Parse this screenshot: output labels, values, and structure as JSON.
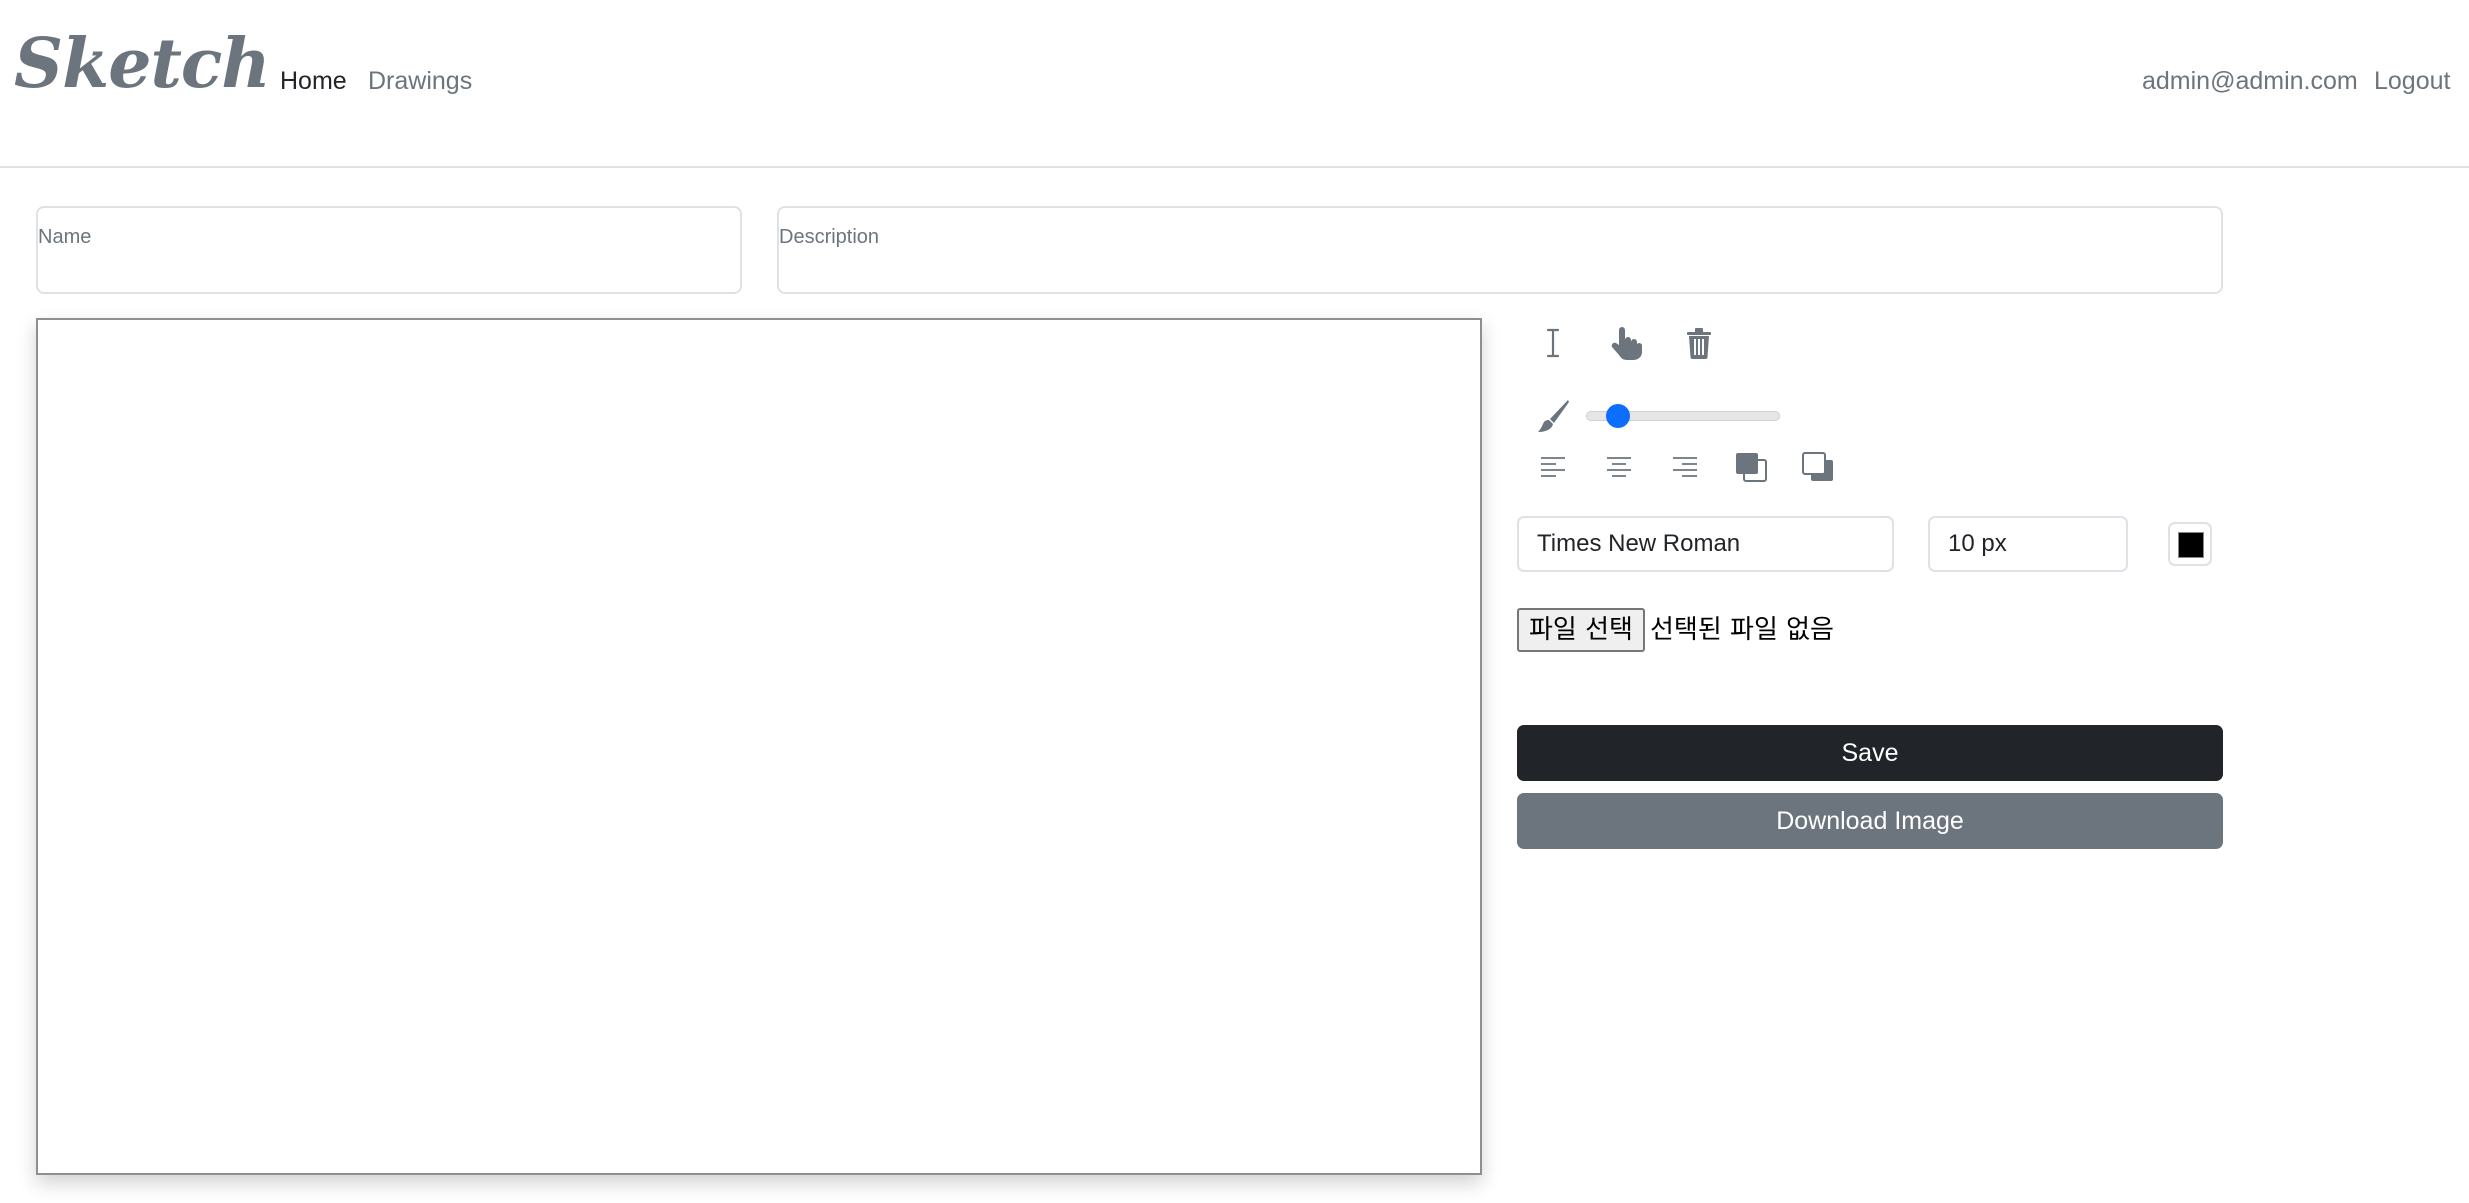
{
  "brand": "Sketch",
  "nav": {
    "home": "Home",
    "drawings": "Drawings",
    "user_email": "admin@admin.com",
    "logout": "Logout"
  },
  "form": {
    "name_label": "Name",
    "description_label": "Description"
  },
  "toolbar": {
    "row1_icons": [
      "text-cursor-icon",
      "hand-pointer-icon",
      "trash-icon"
    ],
    "brush_icon": "paintbrush-icon",
    "brush_size_fraction": 0.12,
    "row2_icons": [
      "align-left-icon",
      "align-center-icon",
      "align-right-icon",
      "bring-to-front-icon",
      "send-to-back-icon"
    ]
  },
  "text_settings": {
    "font_family": "Times New Roman",
    "font_size": "10 px",
    "color": "#000000"
  },
  "file": {
    "button_label": "파일 선택",
    "status": "선택된 파일 없음"
  },
  "actions": {
    "save": "Save",
    "download": "Download Image"
  },
  "colors": {
    "primary_dark": "#212529",
    "secondary": "#6c757d",
    "slider_accent": "#0d6efd"
  }
}
